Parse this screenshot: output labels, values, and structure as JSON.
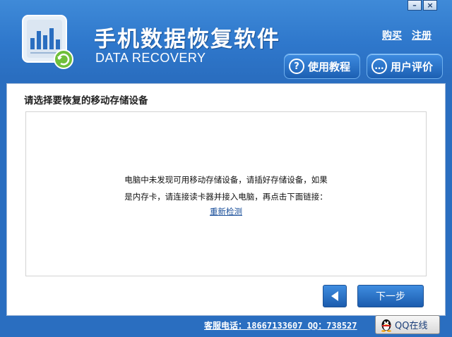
{
  "window": {
    "min_label": "–",
    "close_label": "×"
  },
  "header": {
    "title_cn": "手机数据恢复软件",
    "title_en": "DATA RECOVERY",
    "buy_link": "购买",
    "register_link": "注册",
    "tutorial_button": "使用教程",
    "review_button": "用户评价"
  },
  "main": {
    "prompt": "请选择要恢复的移动存储设备",
    "message_line1": "电脑中未发现可用移动存储设备，请插好存储设备，如果",
    "message_line2": "是内存卡，请连接读卡器并接入电脑，再点击下面链接：",
    "redetect_link": "重新检测",
    "next_button": "下一步"
  },
  "footer": {
    "contact": "客服电话：18667133607 QQ：738527",
    "qq_button": "QQ在线"
  },
  "colors": {
    "header_blue": "#2f78cc",
    "button_blue": "#1b5cae",
    "link_blue": "#1a4f9a"
  },
  "icons": {
    "logo": "data-recovery-logo",
    "tutorial": "question-icon",
    "review": "comment-icon",
    "back": "triangle-left-icon",
    "qq": "qq-penguin-icon"
  }
}
